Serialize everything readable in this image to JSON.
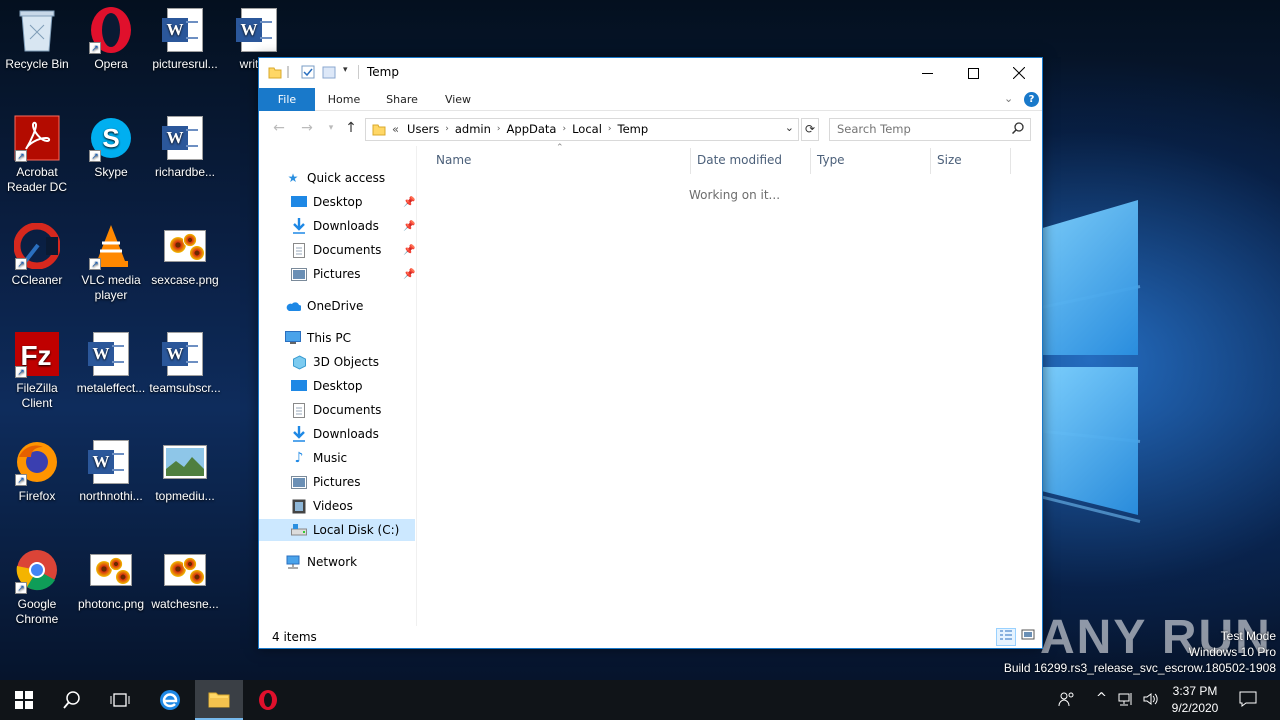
{
  "desktop": {
    "icons": [
      {
        "label": "Recycle Bin",
        "type": "recycle"
      },
      {
        "label": "Opera",
        "type": "opera"
      },
      {
        "label": "picturesrul...",
        "type": "word"
      },
      {
        "label": "writte...",
        "type": "word"
      },
      {
        "label": "Acrobat Reader DC",
        "type": "acrobat"
      },
      {
        "label": "Skype",
        "type": "skype"
      },
      {
        "label": "richardbe...",
        "type": "word"
      },
      {
        "label": "CCleaner",
        "type": "ccleaner"
      },
      {
        "label": "VLC media player",
        "type": "vlc"
      },
      {
        "label": "sexcase.png",
        "type": "png"
      },
      {
        "label": "FileZilla Client",
        "type": "filezilla"
      },
      {
        "label": "metaleffect...",
        "type": "word"
      },
      {
        "label": "teamsubscr...",
        "type": "word"
      },
      {
        "label": "Firefox",
        "type": "firefox"
      },
      {
        "label": "northnothi...",
        "type": "word"
      },
      {
        "label": "topmediu...",
        "type": "landscape"
      },
      {
        "label": "Google Chrome",
        "type": "chrome"
      },
      {
        "label": "photonc.png",
        "type": "png"
      },
      {
        "label": "watchesne...",
        "type": "png"
      }
    ]
  },
  "explorer": {
    "title": "Temp",
    "ribbon_tabs": [
      "File",
      "Home",
      "Share",
      "View"
    ],
    "address": {
      "prefix": "«",
      "crumbs": [
        "Users",
        "admin",
        "AppData",
        "Local",
        "Temp"
      ]
    },
    "search_placeholder": "Search Temp",
    "nav": {
      "quick_access": "Quick access",
      "quick_items": [
        "Desktop",
        "Downloads",
        "Documents",
        "Pictures"
      ],
      "onedrive": "OneDrive",
      "this_pc": "This PC",
      "pc_items": [
        "3D Objects",
        "Desktop",
        "Documents",
        "Downloads",
        "Music",
        "Pictures",
        "Videos",
        "Local Disk (C:)"
      ],
      "network": "Network"
    },
    "columns": [
      "Name",
      "Date modified",
      "Type",
      "Size"
    ],
    "status_message": "Working on it...",
    "item_count": "4 items"
  },
  "watermark": {
    "line1": "Test Mode",
    "line2": "Windows 10 Pro",
    "line3": "Build 16299.rs3_release_svc_escrow.180502-1908",
    "brand": "ANY RUN"
  },
  "taskbar": {
    "time": "3:37 PM",
    "date": "9/2/2020"
  },
  "colors": {
    "accent": "#1979ca",
    "selected": "#cce8ff"
  }
}
